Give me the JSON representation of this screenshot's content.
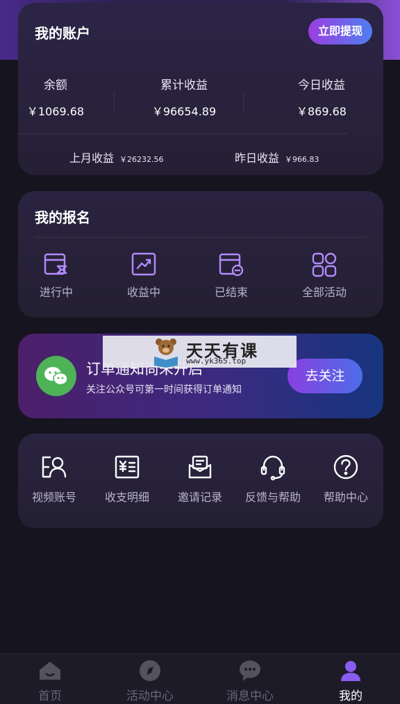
{
  "account": {
    "title": "我的账户",
    "withdraw_label": "立即提现",
    "stats": [
      {
        "label": "余额",
        "value": "￥1069.68"
      },
      {
        "label": "累计收益",
        "value": "￥96654.89"
      },
      {
        "label": "今日收益",
        "value": "￥869.68"
      }
    ],
    "last_month": {
      "label": "上月收益",
      "value": "￥26232.56"
    },
    "yesterday": {
      "label": "昨日收益",
      "value": "￥966.83"
    }
  },
  "signup": {
    "title": "我的报名",
    "items": [
      {
        "label": "进行中",
        "icon": "hourglass-card-icon"
      },
      {
        "label": "收益中",
        "icon": "trend-chart-icon"
      },
      {
        "label": "已结束",
        "icon": "card-minus-icon"
      },
      {
        "label": "全部活动",
        "icon": "grid-icon"
      }
    ]
  },
  "notify": {
    "title": "订单通知尚未开启",
    "subtitle": "关注公众号可第一时间获得订单通知",
    "follow_label": "去关注",
    "icon": "wechat-icon"
  },
  "watermark": {
    "brand": "天天有课",
    "url": "www.yk365.top"
  },
  "tools": [
    {
      "label": "视频账号",
      "icon": "video-account-icon"
    },
    {
      "label": "收支明细",
      "icon": "ledger-icon"
    },
    {
      "label": "邀请记录",
      "icon": "envelope-icon"
    },
    {
      "label": "反馈与帮助",
      "icon": "headset-icon"
    },
    {
      "label": "帮助中心",
      "icon": "question-icon"
    }
  ],
  "tabbar": [
    {
      "label": "首页",
      "icon": "home-icon",
      "active": false
    },
    {
      "label": "活动中心",
      "icon": "compass-icon",
      "active": false
    },
    {
      "label": "消息中心",
      "icon": "chat-icon",
      "active": false
    },
    {
      "label": "我的",
      "icon": "user-icon",
      "active": true
    }
  ],
  "colors": {
    "accent_purple": "#9b3ee0",
    "accent_blue": "#4f7ef0",
    "wechat_green": "#4db356",
    "background": "#15141f"
  }
}
